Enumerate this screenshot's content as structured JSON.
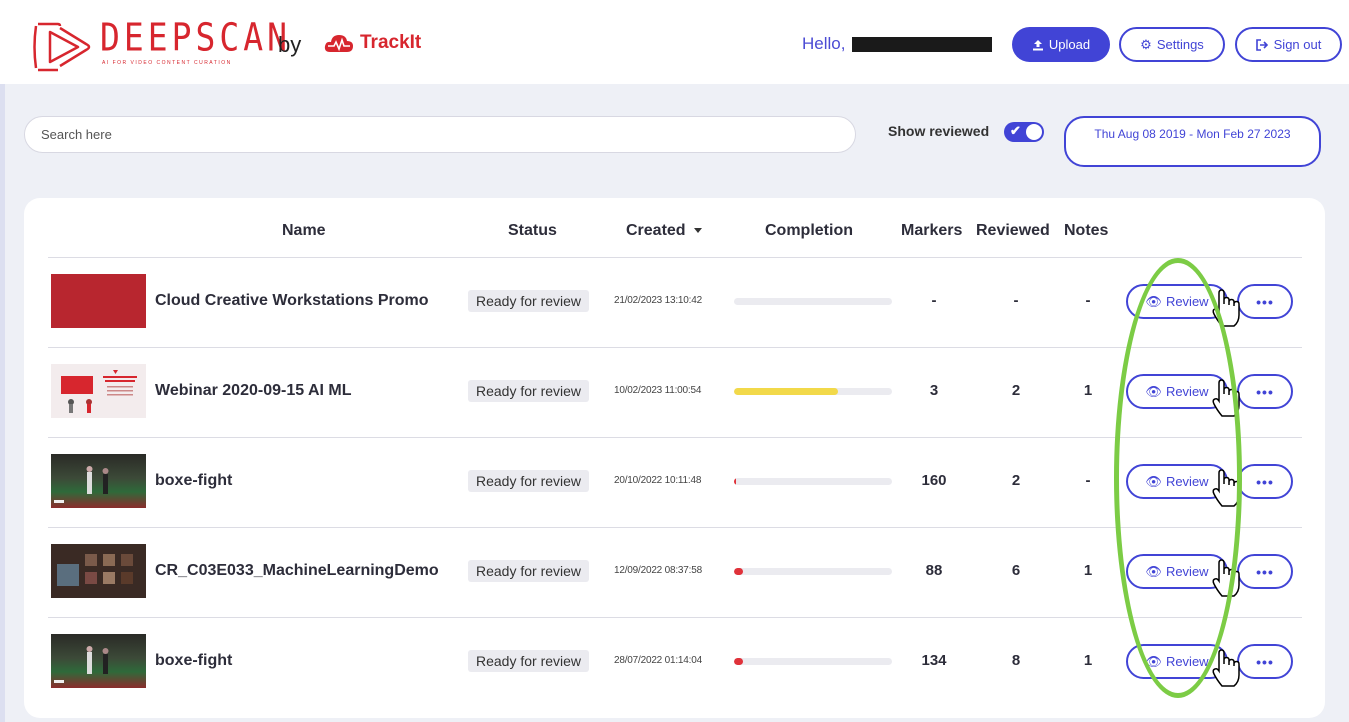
{
  "brand": {
    "name": "DEEPSCAN",
    "tagline": "AI FOR VIDEO CONTENT CURATION",
    "by": "by",
    "partner": "TrackIt",
    "primary_color": "#4144d6",
    "brand_red": "#d7262e"
  },
  "header": {
    "greeting": "Hello,",
    "upload_label": "Upload",
    "settings_label": "Settings",
    "signout_label": "Sign out"
  },
  "filters": {
    "search_placeholder": "Search here",
    "show_reviewed_label": "Show reviewed",
    "show_reviewed_checked": true,
    "date_range": "Thu Aug 08 2019 - Mon Feb 27 2023"
  },
  "table": {
    "columns": {
      "name": "Name",
      "status": "Status",
      "created": "Created",
      "completion": "Completion",
      "markers": "Markers",
      "reviewed": "Reviewed",
      "notes": "Notes"
    },
    "sort_column": "Created",
    "review_label": "Review",
    "more_label": "•••",
    "rows": [
      {
        "name": "Cloud Creative Workstations Promo",
        "status": "Ready for review",
        "created": "21/02/2023 13:10:42",
        "completion": 0,
        "completion_color": "#ebebf0",
        "markers": "-",
        "reviewed": "-",
        "notes": "-"
      },
      {
        "name": "Webinar 2020-09-15 AI ML",
        "status": "Ready for review",
        "created": "10/02/2023 11:00:54",
        "completion": 0.66,
        "completion_color": "#f2d94a",
        "markers": "3",
        "reviewed": "2",
        "notes": "1"
      },
      {
        "name": "boxe-fight",
        "status": "Ready for review",
        "created": "20/10/2022 10:11:48",
        "completion": 0.01,
        "completion_color": "#e0323a",
        "markers": "160",
        "reviewed": "2",
        "notes": "-"
      },
      {
        "name": "CR_C03E033_MachineLearningDemo",
        "status": "Ready for review",
        "created": "12/09/2022 08:37:58",
        "completion": 0.06,
        "completion_color": "#e0323a",
        "markers": "88",
        "reviewed": "6",
        "notes": "1"
      },
      {
        "name": "boxe-fight",
        "status": "Ready for review",
        "created": "28/07/2022 01:14:04",
        "completion": 0.06,
        "completion_color": "#e0323a",
        "markers": "134",
        "reviewed": "8",
        "notes": "1"
      }
    ]
  },
  "annotation": {
    "highlight_color": "#7ccc45"
  }
}
